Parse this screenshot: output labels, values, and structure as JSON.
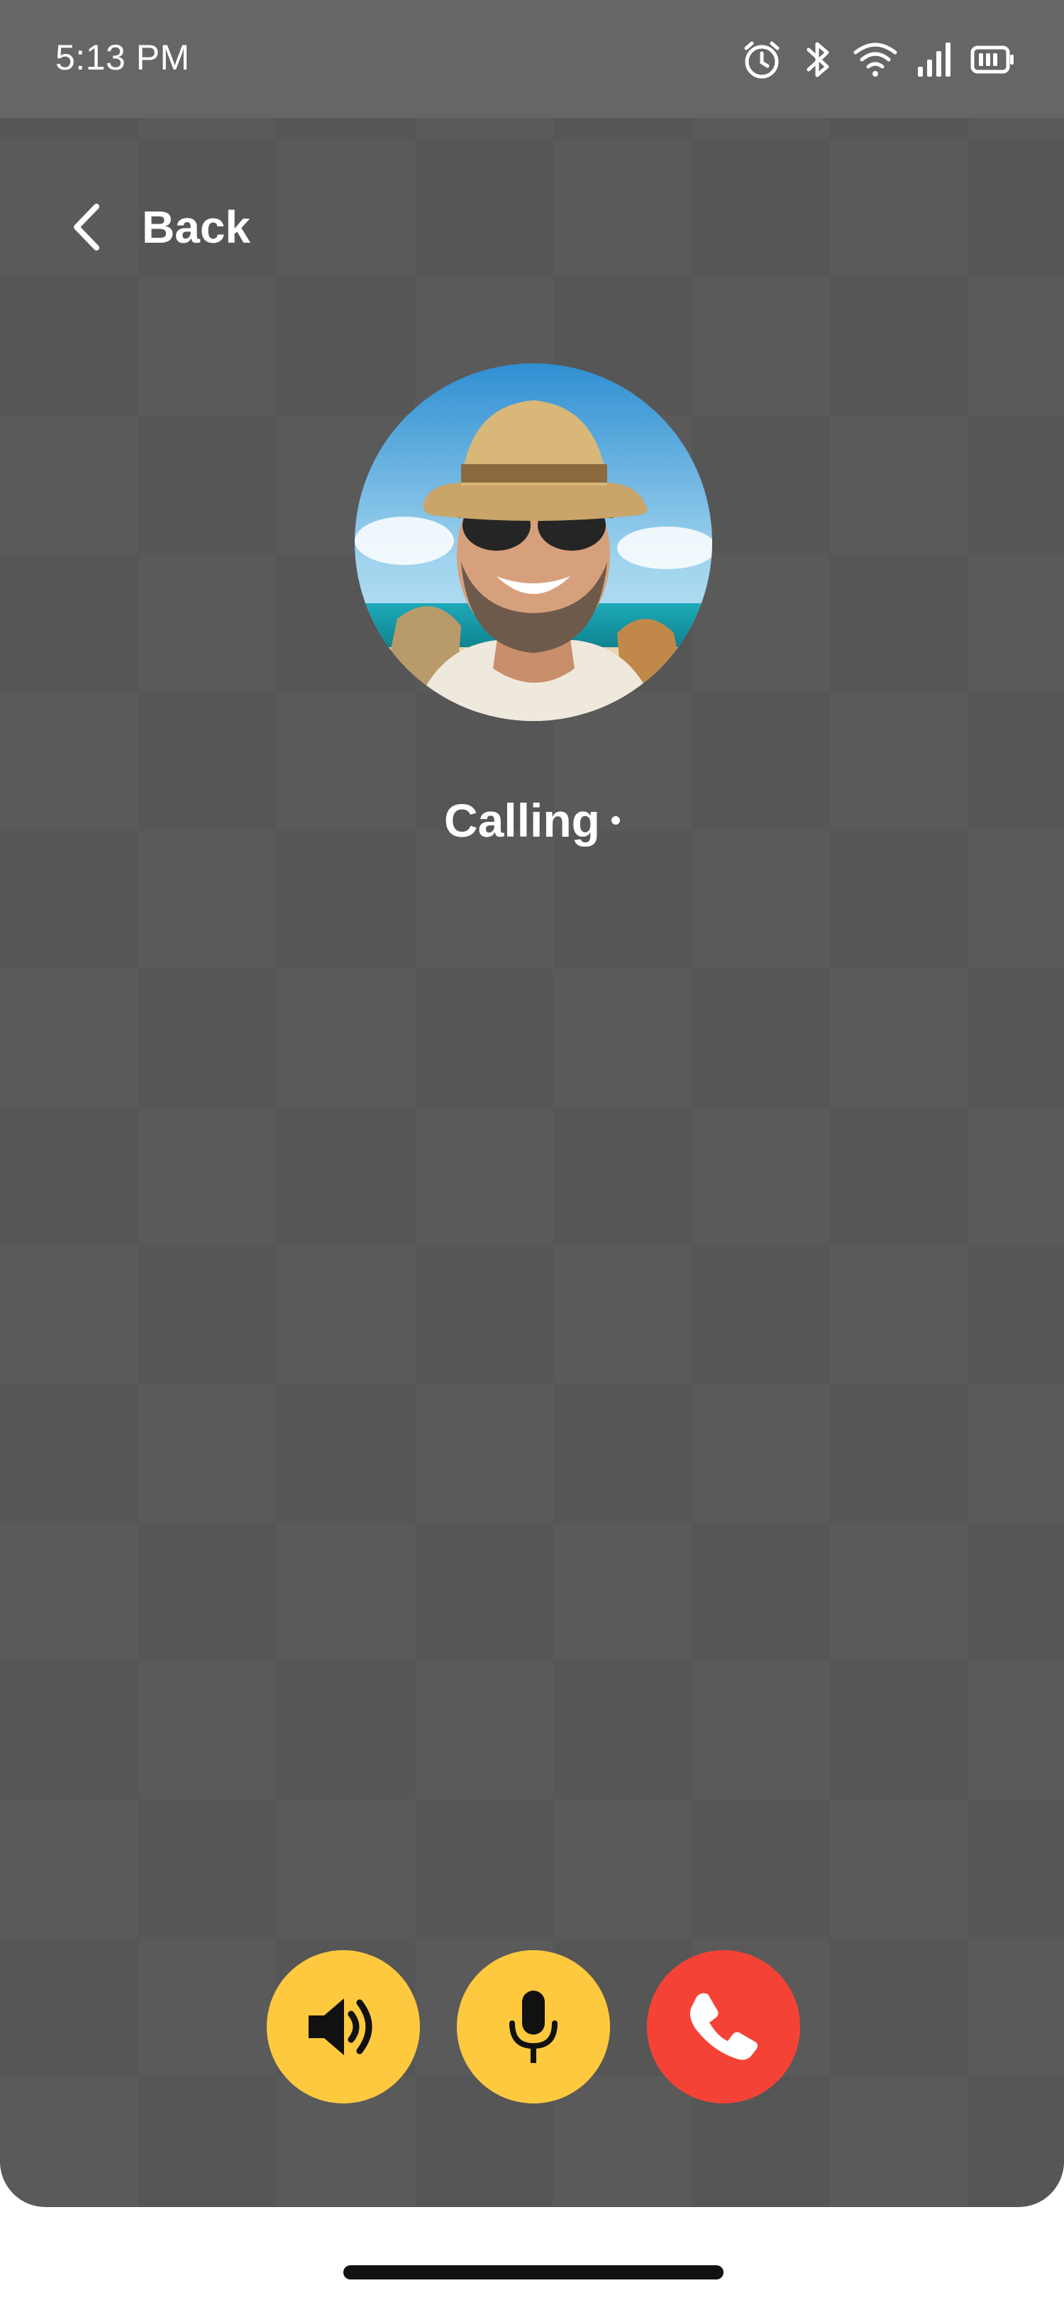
{
  "status_bar": {
    "time": "5:13 PM",
    "icons": [
      "alarm-icon",
      "bluetooth-icon",
      "wifi-icon",
      "signal-icon",
      "battery-icon"
    ]
  },
  "header": {
    "back_label": "Back",
    "back_icon": "chevron-left-icon"
  },
  "call": {
    "status_text": "Calling",
    "avatar": "caller-avatar-photo"
  },
  "controls": {
    "speaker": {
      "icon": "speaker-icon",
      "color": "#FFC93F"
    },
    "mic": {
      "icon": "microphone-icon",
      "color": "#FFC93F"
    },
    "end_call": {
      "icon": "phone-icon",
      "color": "#F44336"
    }
  },
  "colors": {
    "background": "#565656",
    "status_bar": "#666666",
    "accent_yellow": "#FFC93F",
    "end_call_red": "#F44336"
  }
}
